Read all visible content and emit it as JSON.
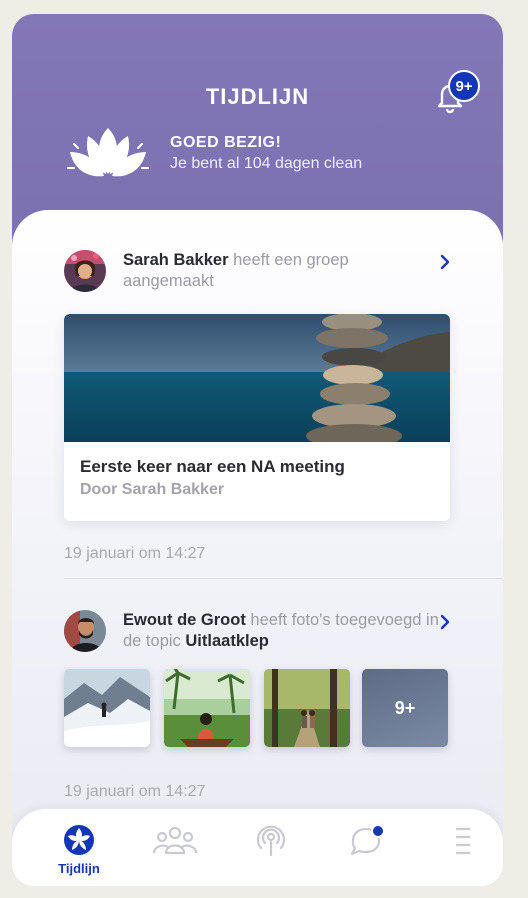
{
  "header": {
    "title": "TIJDLIJN",
    "notification_badge": "9+",
    "streak_title": "GOED BEZIG!",
    "streak_subtitle": "Je bent al 104 dagen clean"
  },
  "feed": [
    {
      "user": "Sarah Bakker",
      "action": "heeft een groep aangemaakt",
      "card_title": "Eerste keer naar een NA meeting",
      "card_subtitle": "Door Sarah Bakker",
      "timestamp": "19 januari om 14:27"
    },
    {
      "user": "Ewout de Groot",
      "action": "heeft foto's toegevoegd in de topic",
      "topic": "Uitlaatklep",
      "more_count": "9+",
      "timestamp": "19 januari om 14:27"
    }
  ],
  "tabbar": {
    "items": [
      {
        "label": "Tijdlijn",
        "icon": "timeline-icon",
        "active": true
      },
      {
        "label": "",
        "icon": "groups-icon"
      },
      {
        "label": "",
        "icon": "podcast-icon"
      },
      {
        "label": "",
        "icon": "chat-icon",
        "has_dot": true
      },
      {
        "label": "",
        "icon": "menu-icon"
      }
    ]
  },
  "colors": {
    "header": "#7e73b3",
    "accent": "#1437b5",
    "background": "#eeede6"
  }
}
